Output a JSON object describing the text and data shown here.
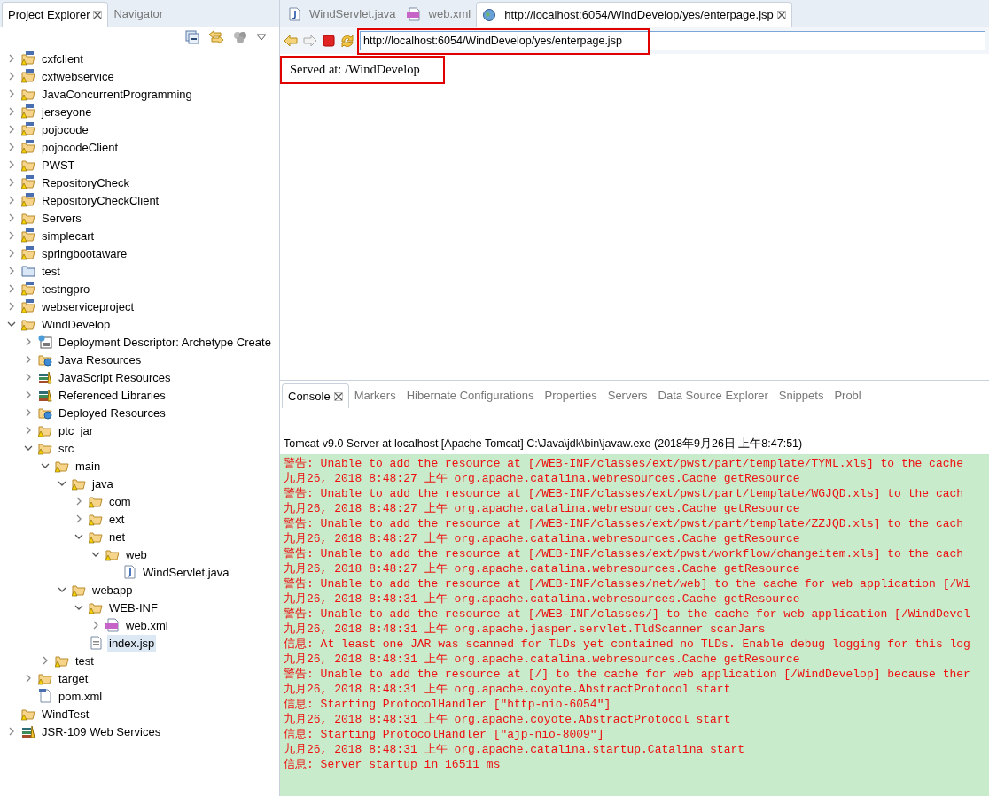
{
  "explorer": {
    "tabs": [
      {
        "label": "Project Explorer",
        "selected": true,
        "closable": true
      },
      {
        "label": "Navigator",
        "selected": false
      }
    ],
    "tree": [
      {
        "label": "cxfclient",
        "kind": "project",
        "expanded": false,
        "selected": false
      },
      {
        "label": "cxfwebservice",
        "kind": "project",
        "expanded": false,
        "selected": false
      },
      {
        "label": "JavaConcurrentProgramming",
        "kind": "folder",
        "expanded": false,
        "selected": false
      },
      {
        "label": "jerseyone",
        "kind": "project",
        "expanded": false,
        "selected": false
      },
      {
        "label": "pojocode",
        "kind": "project",
        "expanded": false,
        "selected": false
      },
      {
        "label": "pojocodeClient",
        "kind": "project",
        "expanded": false,
        "selected": false
      },
      {
        "label": "PWST",
        "kind": "folder",
        "expanded": false,
        "selected": false
      },
      {
        "label": "RepositoryCheck",
        "kind": "project",
        "expanded": false,
        "selected": false
      },
      {
        "label": "RepositoryCheckClient",
        "kind": "project",
        "expanded": false,
        "selected": false
      },
      {
        "label": "Servers",
        "kind": "folder",
        "expanded": false,
        "selected": false
      },
      {
        "label": "simplecart",
        "kind": "project",
        "expanded": false,
        "selected": false
      },
      {
        "label": "springbootaware",
        "kind": "project",
        "expanded": false,
        "selected": false
      },
      {
        "label": "test",
        "kind": "plainfolder",
        "expanded": false,
        "selected": false
      },
      {
        "label": "testngpro",
        "kind": "project",
        "expanded": false,
        "selected": false
      },
      {
        "label": "webserviceproject",
        "kind": "project",
        "expanded": false,
        "selected": false
      },
      {
        "label": "WindDevelop",
        "kind": "folder",
        "expanded": true,
        "selected": false,
        "children": [
          {
            "label": "Deployment Descriptor: Archetype Create",
            "kind": "descriptor",
            "expanded": false,
            "selected": false
          },
          {
            "label": "Java Resources",
            "kind": "resources",
            "expanded": false,
            "selected": false
          },
          {
            "label": "JavaScript Resources",
            "kind": "library",
            "expanded": false,
            "selected": false
          },
          {
            "label": "Referenced Libraries",
            "kind": "library",
            "expanded": false,
            "selected": false
          },
          {
            "label": "Deployed Resources",
            "kind": "resources",
            "expanded": false,
            "selected": false
          },
          {
            "label": "ptc_jar",
            "kind": "folder",
            "expanded": false,
            "selected": false
          },
          {
            "label": "src",
            "kind": "folder",
            "expanded": true,
            "selected": false,
            "children": [
              {
                "label": "main",
                "kind": "folder",
                "expanded": true,
                "selected": false,
                "children": [
                  {
                    "label": "java",
                    "kind": "folder",
                    "expanded": true,
                    "selected": false,
                    "children": [
                      {
                        "label": "com",
                        "kind": "folder",
                        "expanded": false,
                        "selected": false
                      },
                      {
                        "label": "ext",
                        "kind": "folder",
                        "expanded": false,
                        "selected": false
                      },
                      {
                        "label": "net",
                        "kind": "folder",
                        "expanded": true,
                        "selected": false,
                        "children": [
                          {
                            "label": "web",
                            "kind": "folder",
                            "expanded": true,
                            "selected": false,
                            "children": [
                              {
                                "label": "WindServlet.java",
                                "kind": "java",
                                "selected": false
                              }
                            ]
                          }
                        ]
                      }
                    ]
                  },
                  {
                    "label": "webapp",
                    "kind": "folder",
                    "expanded": true,
                    "selected": false,
                    "children": [
                      {
                        "label": "WEB-INF",
                        "kind": "folder",
                        "expanded": true,
                        "selected": false,
                        "children": [
                          {
                            "label": "web.xml",
                            "kind": "xml",
                            "expanded": false,
                            "selected": false
                          }
                        ]
                      },
                      {
                        "label": "index.jsp",
                        "kind": "jsp",
                        "selected": true
                      }
                    ]
                  }
                ]
              },
              {
                "label": "test",
                "kind": "folder",
                "expanded": false,
                "selected": false
              }
            ]
          },
          {
            "label": "target",
            "kind": "folder",
            "expanded": false,
            "selected": false
          },
          {
            "label": "pom.xml",
            "kind": "pom",
            "selected": false
          }
        ]
      },
      {
        "label": "WindTest",
        "kind": "folder",
        "selected": false
      },
      {
        "label": "JSR-109 Web Services",
        "kind": "library",
        "expanded": false,
        "selected": false
      }
    ]
  },
  "editor": {
    "tabs": [
      {
        "label": "WindServlet.java",
        "kind": "java",
        "selected": false
      },
      {
        "label": "web.xml",
        "kind": "xml",
        "selected": false
      },
      {
        "label": "http://localhost:6054/WindDevelop/yes/enterpage.jsp",
        "kind": "globe",
        "selected": true,
        "closable": true
      }
    ],
    "address": "http://localhost:6054/WindDevelop/yes/enterpage.jsp",
    "content": "Served at: /WindDevelop"
  },
  "console": {
    "tabs": [
      {
        "label": "Console",
        "selected": true,
        "closable": true
      },
      {
        "label": "Markers",
        "selected": false
      },
      {
        "label": "Hibernate Configurations",
        "selected": false
      },
      {
        "label": "Properties",
        "selected": false
      },
      {
        "label": "Servers",
        "selected": false
      },
      {
        "label": "Data Source Explorer",
        "selected": false
      },
      {
        "label": "Snippets",
        "selected": false
      },
      {
        "label": "Probl",
        "selected": false
      }
    ],
    "header": "Tomcat v9.0 Server at localhost [Apache Tomcat] C:\\Java\\jdk\\bin\\javaw.exe (2018年9月26日 上午8:47:51)",
    "lines": [
      "警告: Unable to add the resource at [/WEB-INF/classes/ext/pwst/part/template/TYML.xls] to the cache",
      "九月26, 2018 8:48:27 上午 org.apache.catalina.webresources.Cache getResource",
      "警告: Unable to add the resource at [/WEB-INF/classes/ext/pwst/part/template/WGJQD.xls] to the cach",
      "九月26, 2018 8:48:27 上午 org.apache.catalina.webresources.Cache getResource",
      "警告: Unable to add the resource at [/WEB-INF/classes/ext/pwst/part/template/ZZJQD.xls] to the cach",
      "九月26, 2018 8:48:27 上午 org.apache.catalina.webresources.Cache getResource",
      "警告: Unable to add the resource at [/WEB-INF/classes/ext/pwst/workflow/changeitem.xls] to the cach",
      "九月26, 2018 8:48:27 上午 org.apache.catalina.webresources.Cache getResource",
      "警告: Unable to add the resource at [/WEB-INF/classes/net/web] to the cache for web application [/Wi",
      "九月26, 2018 8:48:31 上午 org.apache.catalina.webresources.Cache getResource",
      "警告: Unable to add the resource at [/WEB-INF/classes/] to the cache for web application [/WindDevel",
      "九月26, 2018 8:48:31 上午 org.apache.jasper.servlet.TldScanner scanJars",
      "信息: At least one JAR was scanned for TLDs yet contained no TLDs. Enable debug logging for this log",
      "九月26, 2018 8:48:31 上午 org.apache.catalina.webresources.Cache getResource",
      "警告: Unable to add the resource at [/] to the cache for web application [/WindDevelop] because ther",
      "九月26, 2018 8:48:31 上午 org.apache.coyote.AbstractProtocol start",
      "信息: Starting ProtocolHandler [\"http-nio-6054\"]",
      "九月26, 2018 8:48:31 上午 org.apache.coyote.AbstractProtocol start",
      "信息: Starting ProtocolHandler [\"ajp-nio-8009\"]",
      "九月26, 2018 8:48:31 上午 org.apache.catalina.startup.Catalina start",
      "信息: Server startup in 16511 ms"
    ]
  }
}
